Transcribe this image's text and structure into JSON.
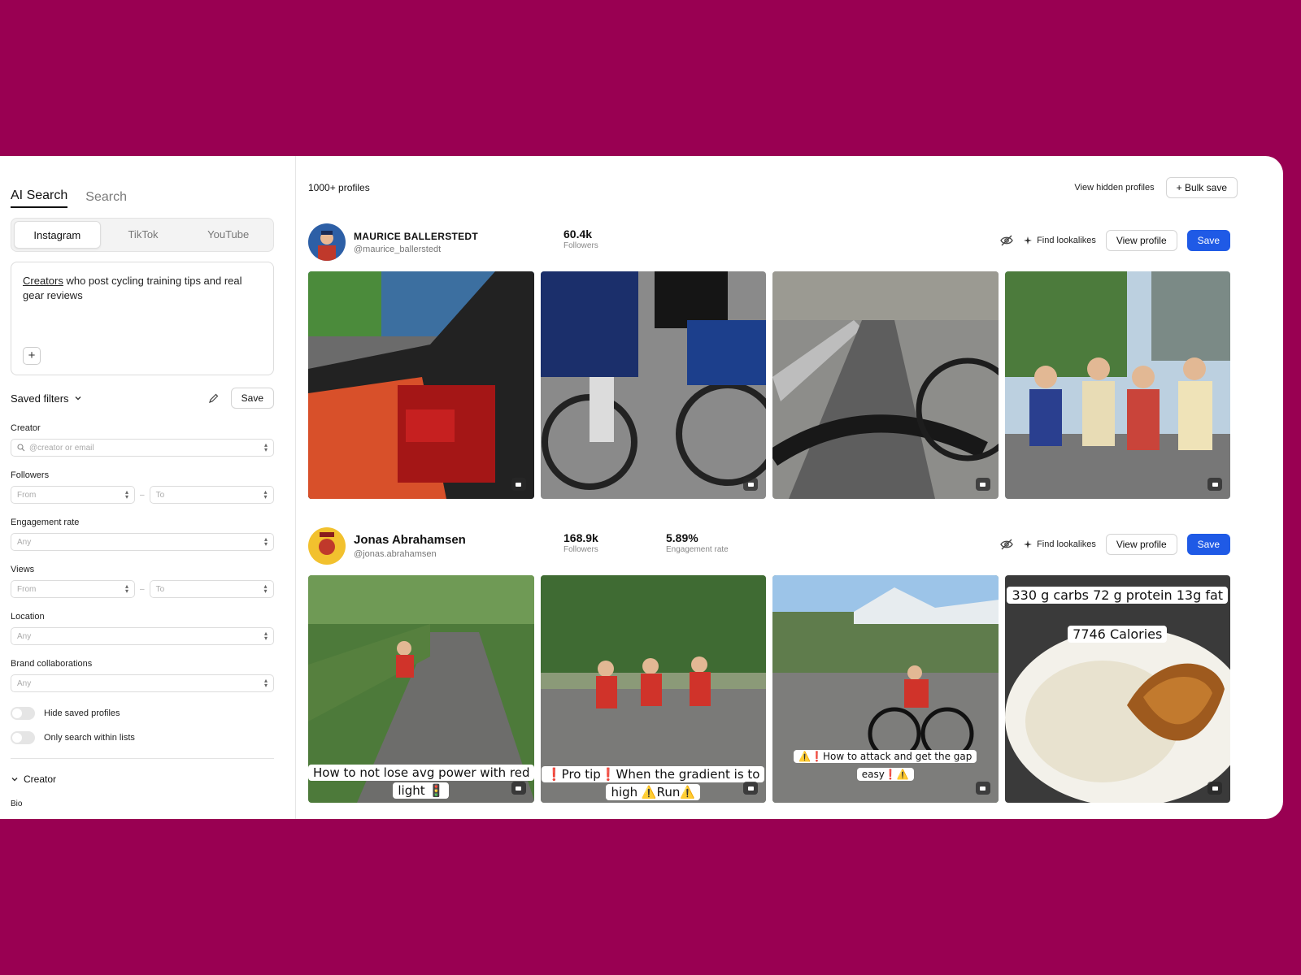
{
  "sidebar": {
    "tabs": [
      "AI Search",
      "Search"
    ],
    "platforms": [
      "Instagram",
      "TikTok",
      "YouTube"
    ],
    "query_underlined": "Creators",
    "query_rest": " who post cycling training tips and real gear reviews",
    "saved_filters_label": "Saved filters",
    "save_label": "Save",
    "filters": {
      "creator_label": "Creator",
      "creator_placeholder": "@creator or email",
      "followers_label": "Followers",
      "from": "From",
      "to": "To",
      "dash": "–",
      "engagement_label": "Engagement rate",
      "any": "Any",
      "views_label": "Views",
      "location_label": "Location",
      "brand_label": "Brand collaborations"
    },
    "toggles": [
      "Hide saved profiles",
      "Only search within lists"
    ],
    "section_creator": "Creator",
    "bio_label": "Bio"
  },
  "results": {
    "count": "1000+ profiles",
    "view_hidden": "View hidden profiles",
    "bulk_save": "+ Bulk save"
  },
  "actions": {
    "find_lookalikes": "Find lookalikes",
    "view_profile": "View profile",
    "save": "Save"
  },
  "profiles": [
    {
      "name": "MAURICE BALLERSTEDT",
      "handle": "@maurice_ballerstedt",
      "followers_value": "60.4k",
      "followers_label": "Followers"
    },
    {
      "name": "Jonas Abrahamsen",
      "handle": "@jonas.abrahamsen",
      "followers_value": "168.9k",
      "followers_label": "Followers",
      "engagement_value": "5.89%",
      "engagement_label": "Engagement rate",
      "captions": [
        "How to not lose avg power with red light 🚦",
        "❗Pro tip❗When the gradient is to high ⚠️Run⚠️",
        "⚠️❗How to attack and get the gap easy❗⚠️",
        "330 g carbs 72 g protein 13g fat",
        "7746 Calories"
      ]
    }
  ],
  "colors": {
    "background": "#990052",
    "accent": "#1f5ae6"
  }
}
